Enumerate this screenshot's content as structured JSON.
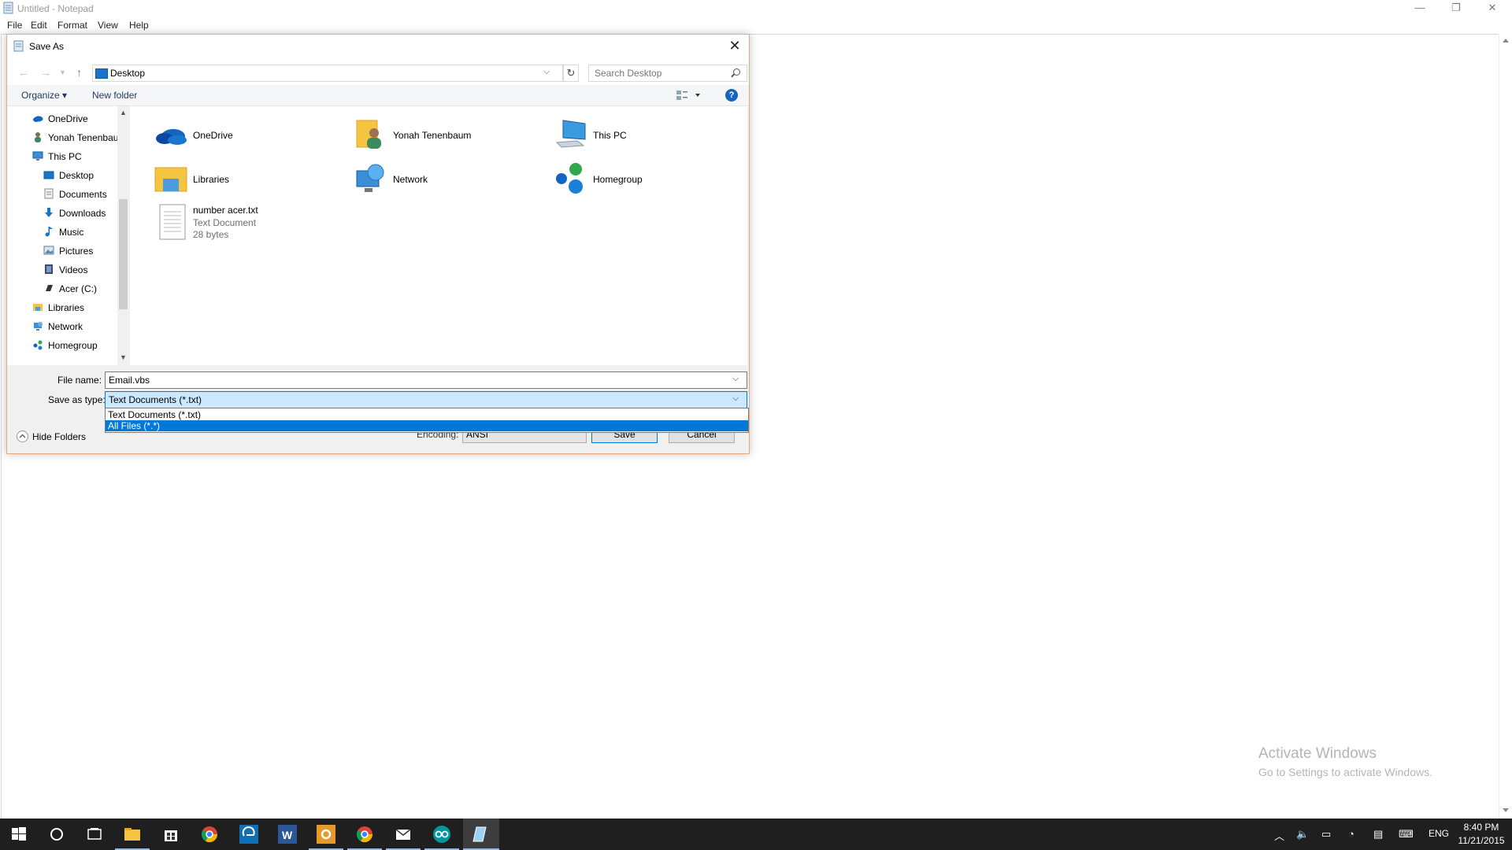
{
  "notepad": {
    "title": "Untitled - Notepad",
    "menu": [
      "File",
      "Edit",
      "Format",
      "View",
      "Help"
    ],
    "controls": {
      "minimize": "—",
      "restore": "❐",
      "close": "✕"
    }
  },
  "dialog": {
    "title": "Save As",
    "close_glyph": "✕",
    "address": "Desktop",
    "search_placeholder": "Search Desktop",
    "organize_label": "Organize ▾",
    "new_folder_label": "New folder",
    "help_glyph": "?",
    "nav_items": [
      {
        "label": "OneDrive",
        "icon": "onedrive-icon"
      },
      {
        "label": "Yonah Tenenbaum",
        "icon": "user-folder-icon"
      },
      {
        "label": "This PC",
        "icon": "this-pc-icon"
      },
      {
        "label": "Desktop",
        "icon": "desktop-icon"
      },
      {
        "label": "Documents",
        "icon": "documents-icon"
      },
      {
        "label": "Downloads",
        "icon": "downloads-icon"
      },
      {
        "label": "Music",
        "icon": "music-icon"
      },
      {
        "label": "Pictures",
        "icon": "pictures-icon"
      },
      {
        "label": "Videos",
        "icon": "videos-icon"
      },
      {
        "label": "Acer (C:)",
        "icon": "drive-icon"
      },
      {
        "label": "Libraries",
        "icon": "libraries-icon"
      },
      {
        "label": "Network",
        "icon": "network-icon"
      },
      {
        "label": "Homegroup",
        "icon": "homegroup-icon"
      }
    ],
    "items": [
      {
        "name": "OneDrive",
        "icon": "onedrive-icon"
      },
      {
        "name": "Yonah Tenenbaum",
        "icon": "user-folder-icon"
      },
      {
        "name": "This PC",
        "icon": "this-pc-icon"
      },
      {
        "name": "Libraries",
        "icon": "libraries-icon"
      },
      {
        "name": "Network",
        "icon": "network-icon"
      },
      {
        "name": "Homegroup",
        "icon": "homegroup-icon"
      }
    ],
    "file": {
      "name": "number acer.txt",
      "type": "Text Document",
      "size": "28 bytes"
    },
    "filename_label": "File name:",
    "filename_value": "Email.vbs",
    "savetype_label": "Save as type:",
    "savetype_value": "Text Documents (*.txt)",
    "savetype_options": [
      "Text Documents (*.txt)",
      "All Files  (*.*)"
    ],
    "hide_folders_label": "Hide Folders",
    "encoding_label": "Encoding:",
    "encoding_value": "ANSI",
    "save_label": "Save",
    "cancel_label": "Cancel"
  },
  "watermark": {
    "line1": "Activate Windows",
    "line2": "Go to Settings to activate Windows."
  },
  "taskbar": {
    "time": "8:40 PM",
    "date": "11/21/2015",
    "language": "ENG"
  }
}
